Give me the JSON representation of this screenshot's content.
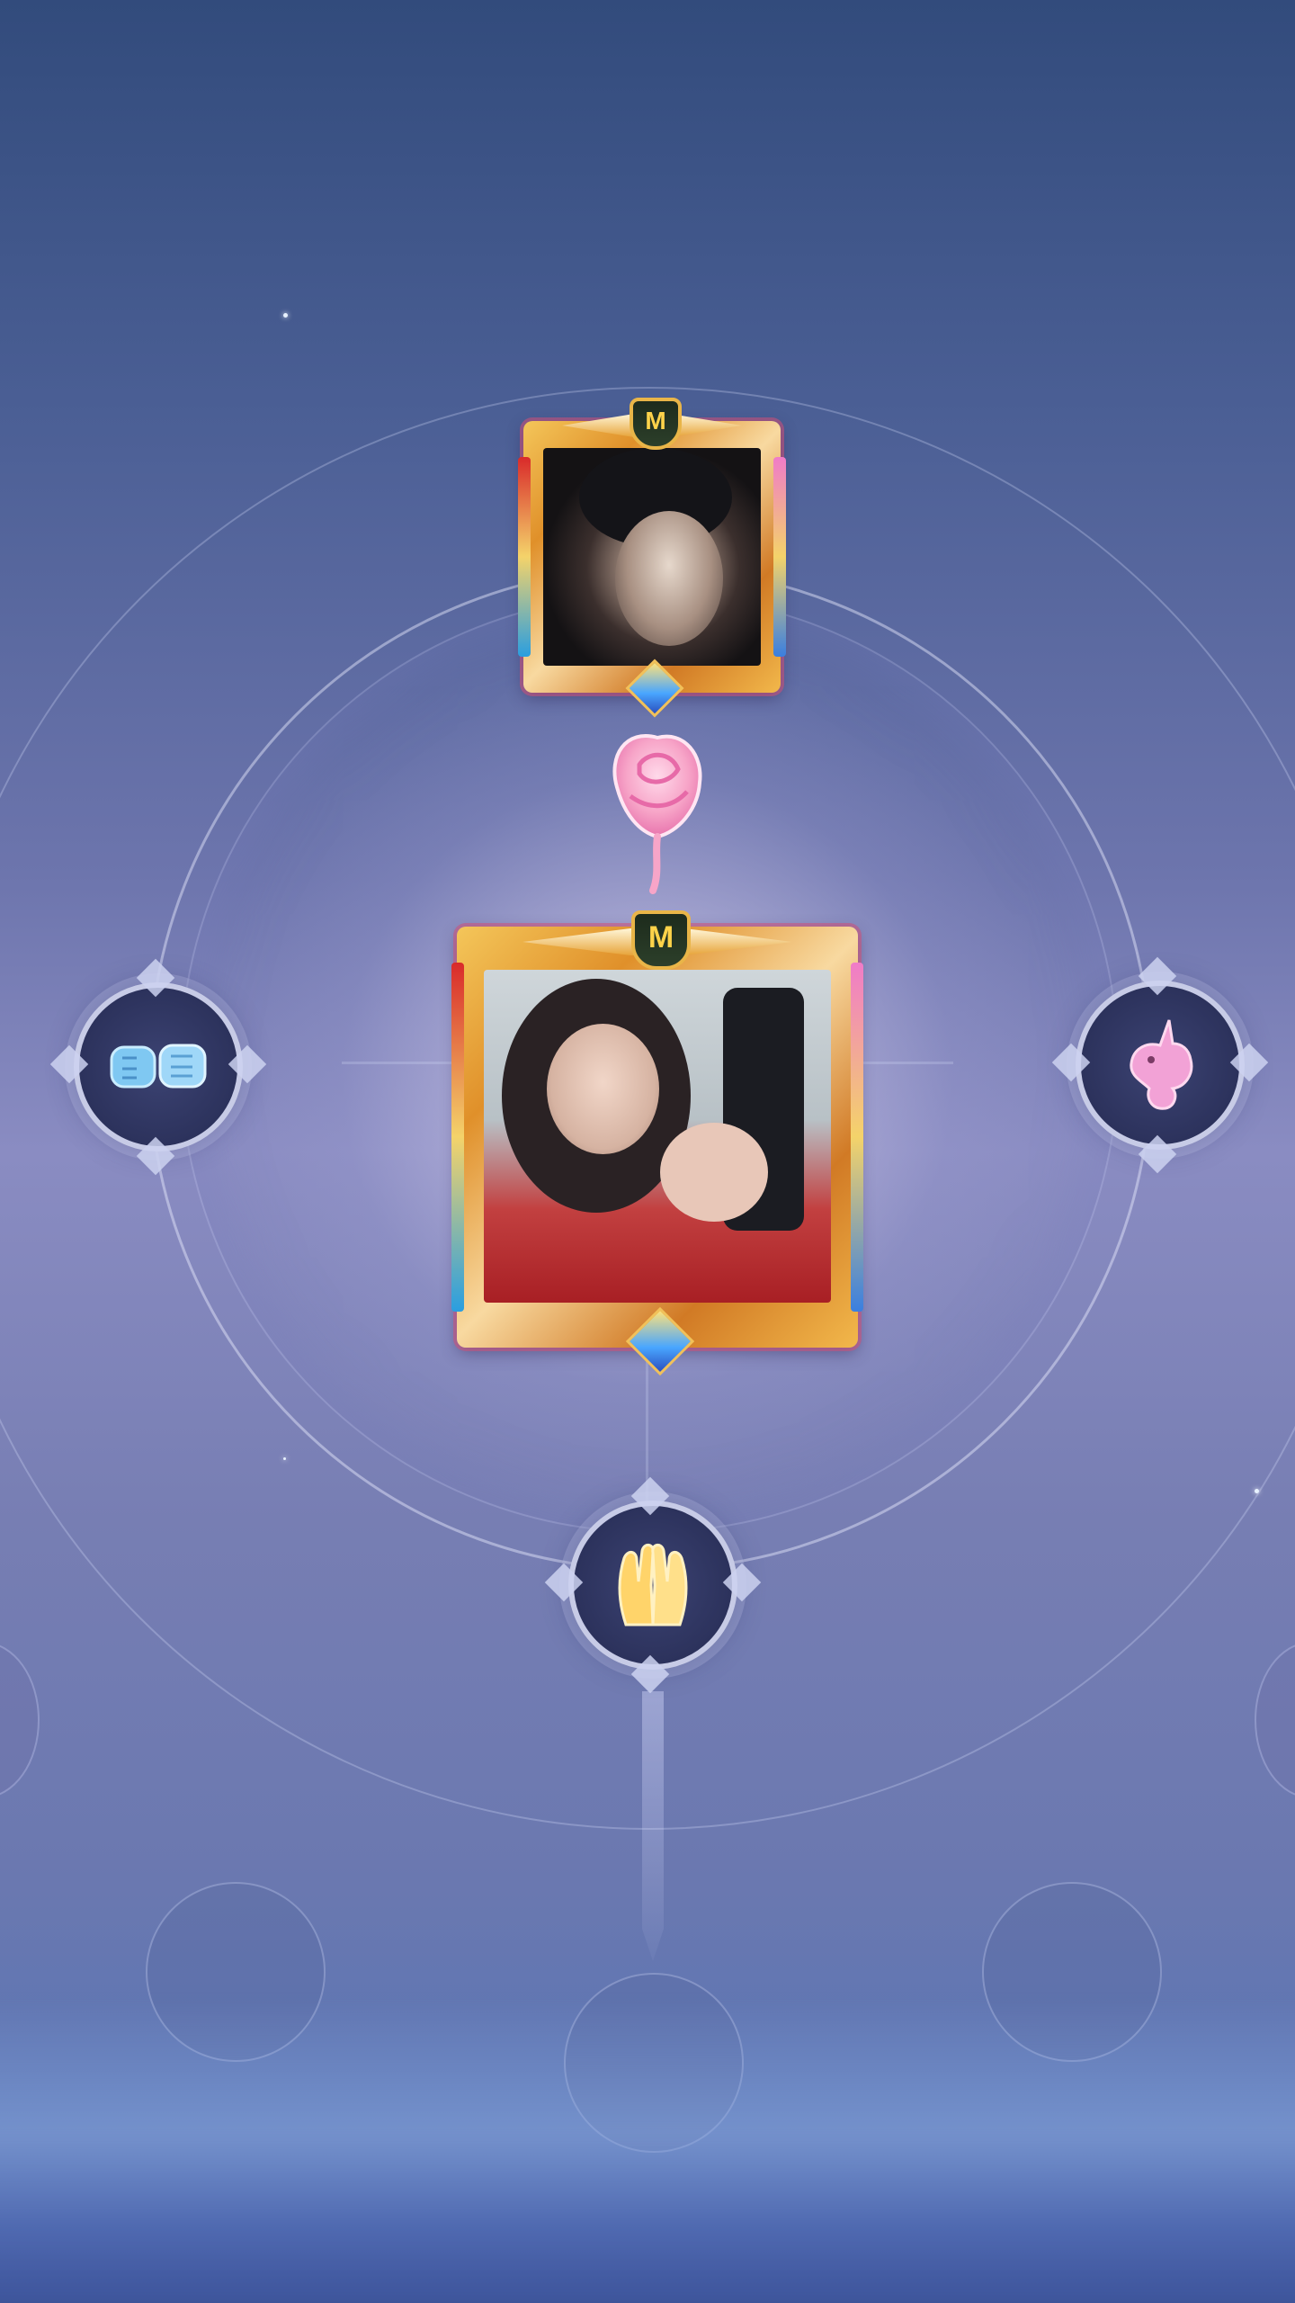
{
  "screen": "emote-interaction",
  "colors": {
    "background_top": "#324b7c",
    "background_mid": "#8a8cc2",
    "frame_gold": "#f4c65a",
    "rose_pink": "#f7a5c8",
    "fist_blue": "#7fc8f2",
    "unicorn_pink": "#f2a2d6",
    "hands_yellow": "#ffd46a"
  },
  "players": {
    "target": {
      "avatar_icon": "anime-character-portrait",
      "frame": "gold-crest-frame",
      "crest_letter": "M"
    },
    "self": {
      "avatar_icon": "player-selfie-photo",
      "frame": "gold-crest-frame",
      "crest_letter": "M"
    }
  },
  "interaction": {
    "effect_icon": "rose-icon"
  },
  "emotes": [
    {
      "id": "fist-bump",
      "icon": "fist-bump-icon"
    },
    {
      "id": "unicorn",
      "icon": "unicorn-icon"
    },
    {
      "id": "high-five",
      "icon": "clapping-hands-icon"
    }
  ],
  "empty_slots": 5
}
